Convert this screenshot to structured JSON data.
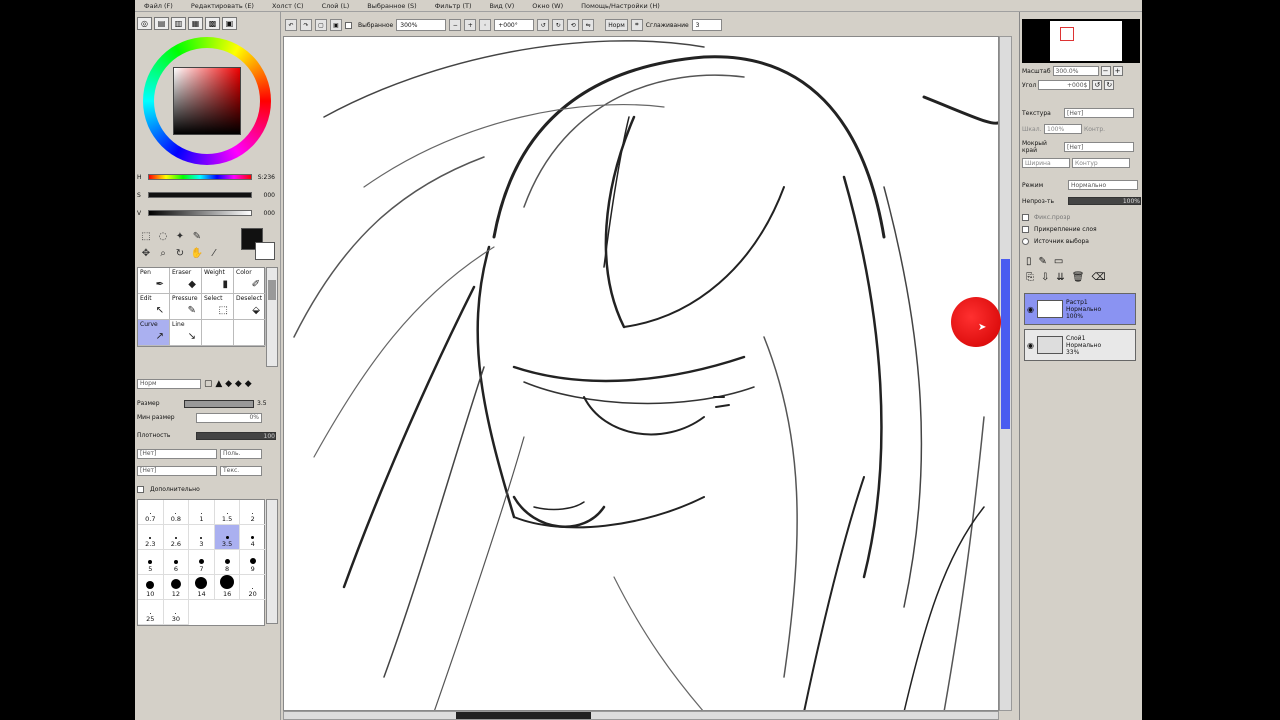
{
  "menu": [
    "Файл (F)",
    "Редактировать (E)",
    "Холст (C)",
    "Слой (L)",
    "Выбранное (S)",
    "Фильтр (T)",
    "Вид (V)",
    "Окно (W)",
    "Помощь/Настройки (H)"
  ],
  "toolbar": {
    "selection_label": "Выбранное",
    "zoom_value": "300%",
    "rotation_value": "+000°",
    "normal_button": "Норм",
    "smoothing_label": "Сглаживание",
    "smoothing_value": "3"
  },
  "color": {
    "h_label": "H",
    "h_value": "S:236",
    "s_label": "S",
    "s_value": "000",
    "v_label": "V",
    "v_value": "000",
    "primary": "#111111",
    "secondary": "#ffffff"
  },
  "brushes": [
    {
      "label": "Pen",
      "icon": "pen-icon"
    },
    {
      "label": "Eraser",
      "icon": "eraser-icon"
    },
    {
      "label": "Weight",
      "icon": "weight-icon"
    },
    {
      "label": "Color",
      "icon": "color-icon"
    },
    {
      "label": "Edit",
      "icon": "edit-icon"
    },
    {
      "label": "Pressure",
      "icon": "pressure-icon"
    },
    {
      "label": "Select",
      "icon": "select-icon"
    },
    {
      "label": "Deselect",
      "icon": "deselect-icon"
    },
    {
      "label": "Curve",
      "icon": "curve-icon",
      "selected": true
    },
    {
      "label": "Line",
      "icon": "line-icon"
    }
  ],
  "brush_props": {
    "mode_value": "Норм",
    "size_label": "Размер",
    "size_value": "3.5",
    "min_size_label": "Мин размер",
    "min_size_value": "0%",
    "density_label": "Плотность",
    "density_value": "100",
    "shape1": "[Нет]",
    "shape1_btn": "Поль.",
    "shape2": "[Нет]",
    "shape2_btn": "Текс.",
    "advanced_label": "Дополнительно"
  },
  "sizes": [
    {
      "v": "0.7",
      "d": 0
    },
    {
      "v": "0.8",
      "d": 0
    },
    {
      "v": "1",
      "d": 0
    },
    {
      "v": "1.5",
      "d": 0
    },
    {
      "v": "2",
      "d": 0
    },
    {
      "v": "2.3",
      "d": 1
    },
    {
      "v": "2.6",
      "d": 1
    },
    {
      "v": "3",
      "d": 1
    },
    {
      "v": "3.5",
      "d": 2,
      "selected": true
    },
    {
      "v": "4",
      "d": 2
    },
    {
      "v": "5",
      "d": 3
    },
    {
      "v": "6",
      "d": 3
    },
    {
      "v": "7",
      "d": 4
    },
    {
      "v": "8",
      "d": 4
    },
    {
      "v": "9",
      "d": 5
    },
    {
      "v": "10",
      "d": 6
    },
    {
      "v": "12",
      "d": 7
    },
    {
      "v": "14",
      "d": 8
    },
    {
      "v": "16",
      "d": 10
    },
    {
      "v": "20",
      "d": 12
    },
    {
      "v": "25",
      "d": 14
    },
    {
      "v": "30",
      "d": 15
    }
  ],
  "navigator": {
    "zoom_label": "Масштаб",
    "zoom_value": "300.0%",
    "angle_label": "Угол",
    "angle_value": "+000$"
  },
  "layer_props": {
    "texture_label": "Текстура",
    "texture_value": "[Нет]",
    "scale_label": "Шкал.",
    "scale_value": "100%",
    "contrast_label": "Контр.",
    "edge_label": "Мокрый край",
    "edge_value": "[Нет]",
    "width_label": "Ширина",
    "color_btn": "Контур",
    "blend_label": "Режим",
    "blend_value": "Нормально",
    "opacity_label": "Непроз-ть",
    "opacity_value": "100%",
    "lock_label": "Фикс.прозр",
    "clip_label": "Прикрепление слоя",
    "source_label": "Источник выбора"
  },
  "layers": [
    {
      "name": "Растр1",
      "mode": "Нормально",
      "opacity": "100%",
      "selected": true
    },
    {
      "name": "Слой1",
      "mode": "Нормально",
      "opacity": "33%",
      "selected": false
    }
  ],
  "accent": "#4a5cf0"
}
